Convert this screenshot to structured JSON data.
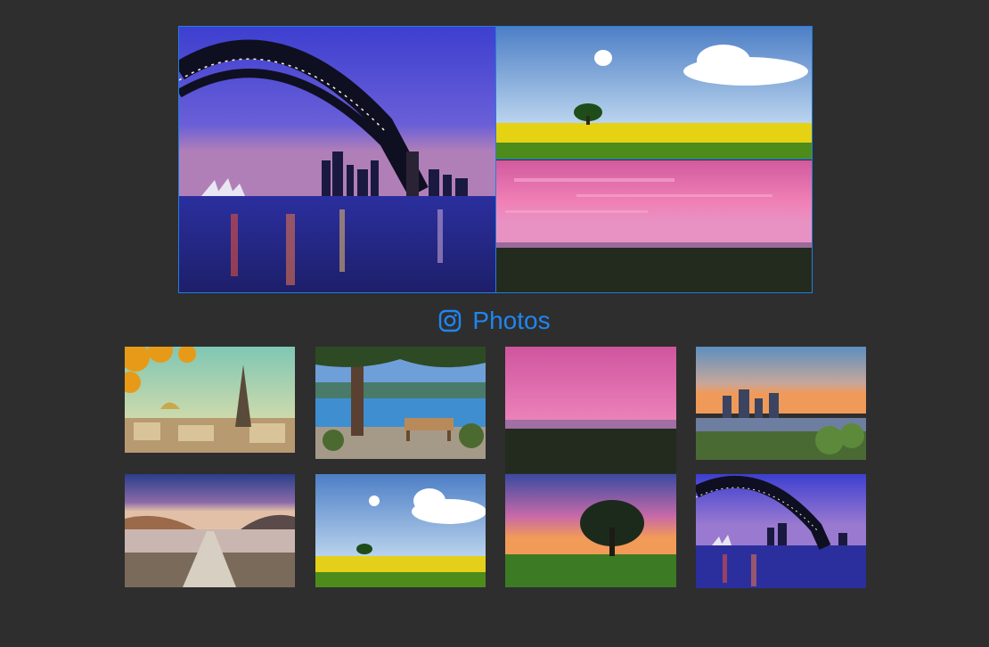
{
  "gallery": {
    "title": "Photos",
    "icon": "instagram-icon",
    "accent_color": "#1f86f0",
    "featured": [
      {
        "scene": "harbour-bridge-night"
      },
      {
        "scene": "tree-rapeseed-field"
      },
      {
        "scene": "pink-sunset-field"
      }
    ],
    "thumbnails": [
      {
        "scene": "eiffel-tower-autumn"
      },
      {
        "scene": "lake-bench-tree"
      },
      {
        "scene": "pink-sunset-field"
      },
      {
        "scene": "city-river-skyline"
      },
      {
        "scene": "lake-pier-mountains"
      },
      {
        "scene": "tree-rapeseed-field"
      },
      {
        "scene": "lone-tree-sunset"
      },
      {
        "scene": "harbour-bridge-night"
      }
    ]
  }
}
